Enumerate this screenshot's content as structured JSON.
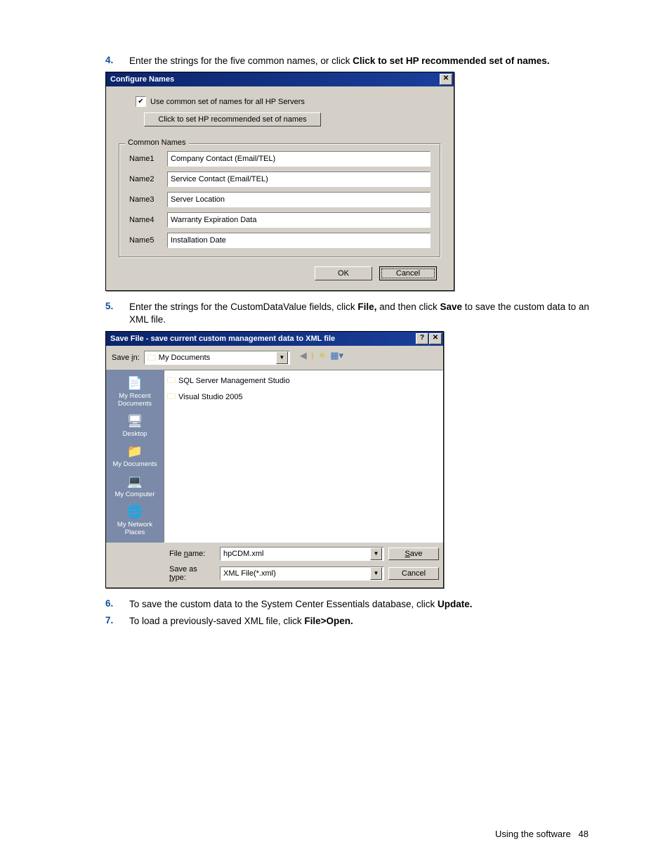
{
  "steps": [
    {
      "num": "4.",
      "text_a": "Enter the strings for the five common names, or click ",
      "bold": "Click to set HP recommended set of names."
    },
    {
      "num": "5.",
      "text_a": "Enter the strings for the CustomDataValue fields, click ",
      "bold_a": "File,",
      "text_b": " and then click ",
      "bold_b": "Save",
      "text_c": " to save the custom data to an XML file."
    },
    {
      "num": "6.",
      "text_a": "To save the custom data to the System Center Essentials database, click ",
      "bold": "Update."
    },
    {
      "num": "7.",
      "text_a": "To load a previously-saved XML file, click ",
      "bold": "File>Open."
    }
  ],
  "dialog1": {
    "title": "Configure Names",
    "checkbox_label": "Use common set of names for all HP Servers",
    "recommend_btn": "Click to set HP recommended set of names",
    "fieldset_label": "Common Names",
    "names": [
      {
        "label": "Name1",
        "value": "Company Contact (Email/TEL)"
      },
      {
        "label": "Name2",
        "value": "Service Contact (Email/TEL)"
      },
      {
        "label": "Name3",
        "value": "Server Location"
      },
      {
        "label": "Name4",
        "value": "Warranty Expiration Data"
      },
      {
        "label": "Name5",
        "value": "Installation Date"
      }
    ],
    "ok": "OK",
    "cancel": "Cancel"
  },
  "dialog2": {
    "title": "Save File - save current custom management data to XML file",
    "save_in_pre": "Save ",
    "save_in_u": "i",
    "save_in_post": "n:",
    "save_in_value": "My Documents",
    "places": [
      "My Recent Documents",
      "Desktop",
      "My Documents",
      "My Computer",
      "My Network Places"
    ],
    "files": [
      "SQL Server Management Studio",
      "Visual Studio 2005"
    ],
    "filename_label_a": "File ",
    "filename_label_u": "n",
    "filename_label_b": "ame:",
    "filename_value": "hpCDM.xml",
    "type_label_a": "Save as ",
    "type_label_u": "t",
    "type_label_b": "ype:",
    "type_value": "XML File(*.xml)",
    "save_btn_u": "S",
    "save_btn_rest": "ave",
    "cancel_btn": "Cancel"
  },
  "footer": {
    "text": "Using the software",
    "page": "48"
  }
}
